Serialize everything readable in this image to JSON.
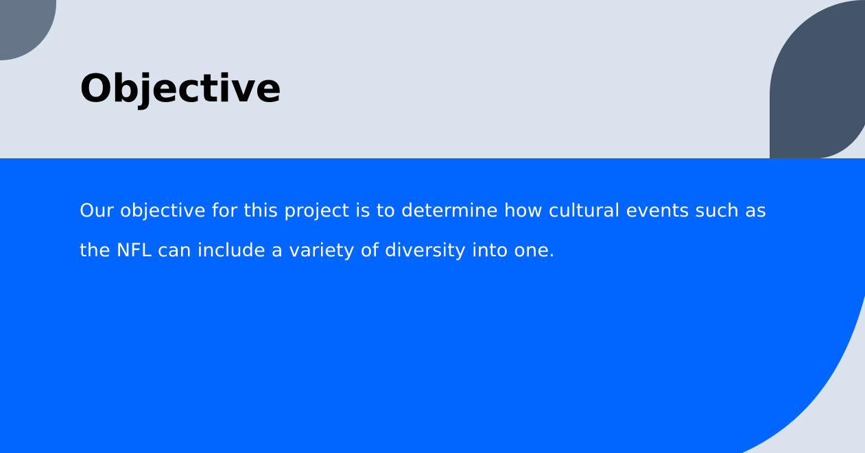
{
  "slide": {
    "title": "Objective",
    "body": "Our objective for this project is to determine how cultural events such as the NFL can include a variety of diversity into one."
  },
  "colors": {
    "background": "#dae3ed",
    "panel": "#0066ff",
    "leaf": "#44546a",
    "corner": "#667587",
    "title_text": "#000000",
    "body_text": "#ffffff"
  }
}
